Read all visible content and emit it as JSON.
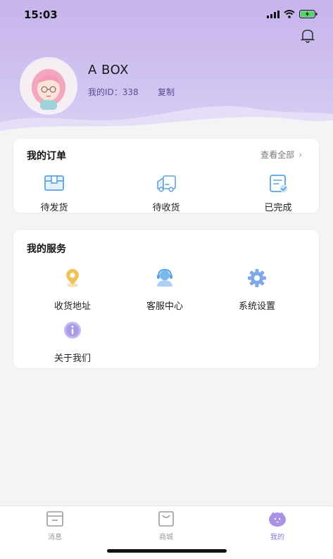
{
  "status_bar": {
    "time": "15:03"
  },
  "profile": {
    "username": "A BOX",
    "id_text": "我的ID：338",
    "copy_label": "复制"
  },
  "orders": {
    "title": "我的订单",
    "view_all": "查看全部",
    "items": [
      {
        "label": "待发货",
        "icon": "box-icon"
      },
      {
        "label": "待收货",
        "icon": "truck-icon"
      },
      {
        "label": "已完成",
        "icon": "clipboard-check-icon"
      }
    ]
  },
  "services": {
    "title": "我的服务",
    "items": [
      {
        "label": "收货地址",
        "icon": "location-pin-icon"
      },
      {
        "label": "客服中心",
        "icon": "customer-service-icon"
      },
      {
        "label": "系统设置",
        "icon": "gear-icon"
      },
      {
        "label": "关于我们",
        "icon": "info-icon"
      }
    ]
  },
  "tabbar": {
    "tabs": [
      {
        "label": "消息",
        "icon": "message-icon"
      },
      {
        "label": "商城",
        "icon": "shopping-bag-icon"
      },
      {
        "label": "我的",
        "icon": "profile-icon",
        "active": true
      }
    ]
  },
  "colors": {
    "header_top": "#c6b4ec",
    "accent_blue": "#5aa2e0",
    "accent_purple": "#8a7ad8",
    "accent_yellow": "#f1c25a"
  }
}
